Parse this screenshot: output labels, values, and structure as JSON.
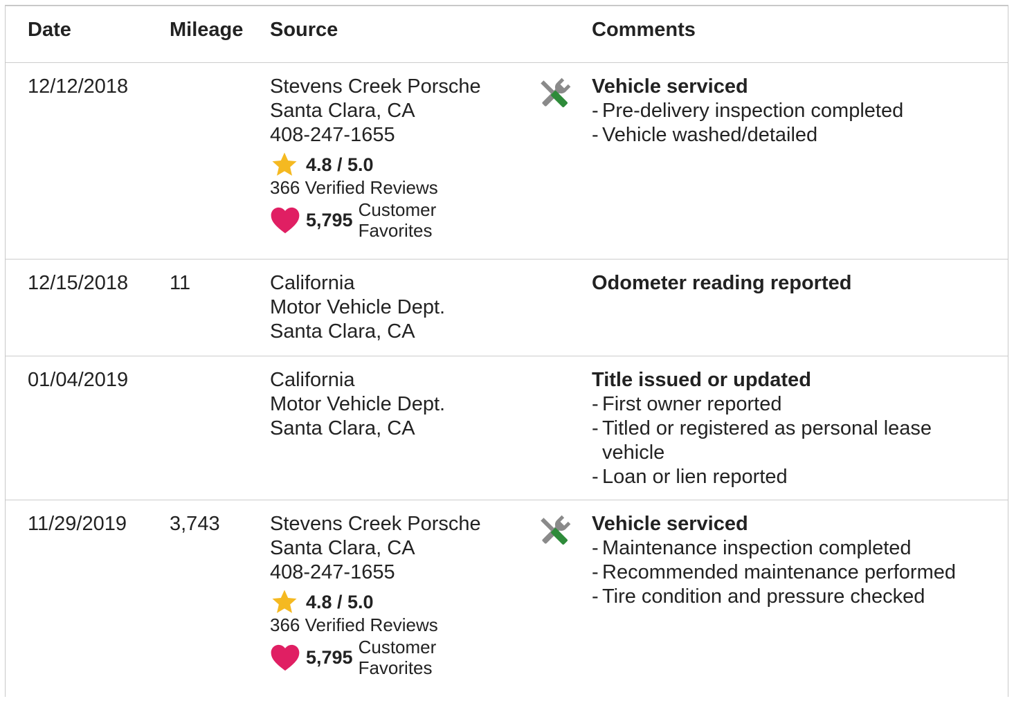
{
  "header": {
    "date": "Date",
    "mileage": "Mileage",
    "source": "Source",
    "comments": "Comments"
  },
  "records": [
    {
      "date": "12/12/2018",
      "mileage": "",
      "source": [
        "Stevens Creek Porsche",
        "Santa Clara, CA",
        "408-247-1655"
      ],
      "rating": "4.8 / 5.0",
      "reviews": "366 Verified Reviews",
      "favorites_count": "5,795",
      "favorites_label_1": "Customer",
      "favorites_label_2": "Favorites",
      "icon": "service-wrench-icon",
      "title": "Vehicle serviced",
      "items": [
        "Pre-delivery inspection completed",
        "Vehicle washed/detailed"
      ]
    },
    {
      "date": "12/15/2018",
      "mileage": "11",
      "source": [
        "California",
        "Motor Vehicle Dept.",
        "Santa Clara, CA"
      ],
      "title": "Odometer reading reported",
      "items": []
    },
    {
      "date": "01/04/2019",
      "mileage": "",
      "source": [
        "California",
        "Motor Vehicle Dept.",
        "Santa Clara, CA"
      ],
      "title": "Title issued or updated",
      "items": [
        "First owner reported",
        "Titled or registered as personal lease vehicle",
        "Loan or lien reported"
      ]
    },
    {
      "date": "11/29/2019",
      "mileage": "3,743",
      "source": [
        "Stevens Creek Porsche",
        "Santa Clara, CA",
        "408-247-1655"
      ],
      "rating": "4.8 / 5.0",
      "reviews": "366 Verified Reviews",
      "favorites_count": "5,795",
      "favorites_label_1": "Customer",
      "favorites_label_2": "Favorites",
      "icon": "service-wrench-icon",
      "title": "Vehicle serviced",
      "items": [
        "Maintenance inspection completed",
        "Recommended maintenance performed",
        "Tire condition and pressure checked"
      ]
    }
  ],
  "dash": "-",
  "colors": {
    "star": "#f5b921",
    "heart": "#e01f63",
    "tool_gray": "#8a8a8a",
    "tool_green": "#2e8b3a",
    "border": "#cccccc"
  }
}
